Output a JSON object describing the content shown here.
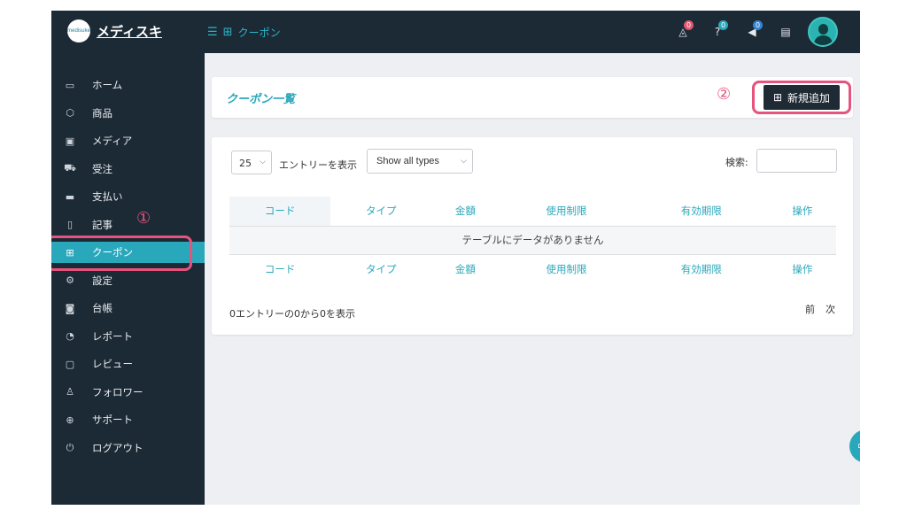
{
  "header": {
    "logo_text": "medisuke",
    "brand": "メディスキ",
    "breadcrumb_icon": "gift-icon",
    "breadcrumb": "クーポン",
    "notifications": {
      "icon": "bell-icon",
      "count": "0",
      "color": "#e2546f"
    },
    "help": {
      "icon": "question-icon",
      "count": "0",
      "color": "#2aa8bb"
    },
    "announcements": {
      "icon": "megaphone-icon",
      "count": "0",
      "color": "#2f86d6"
    },
    "book_icon": "book-icon"
  },
  "sidebar": {
    "items": [
      {
        "label": "ホーム",
        "icon": "monitor-icon",
        "glyph": "▭"
      },
      {
        "label": "商品",
        "icon": "cube-icon",
        "glyph": "⬡"
      },
      {
        "label": "メディア",
        "icon": "image-icon",
        "glyph": "▣"
      },
      {
        "label": "受注",
        "icon": "cart-icon",
        "glyph": "⛟"
      },
      {
        "label": "支払い",
        "icon": "card-icon",
        "glyph": "▬"
      },
      {
        "label": "記事",
        "icon": "document-icon",
        "glyph": "▯"
      },
      {
        "label": "クーポン",
        "icon": "gift-icon",
        "glyph": "⊞",
        "active": true
      },
      {
        "label": "設定",
        "icon": "gears-icon",
        "glyph": "⚙"
      },
      {
        "label": "台帳",
        "icon": "money-icon",
        "glyph": "◙"
      },
      {
        "label": "レポート",
        "icon": "chart-pie-icon",
        "glyph": "◔"
      },
      {
        "label": "レビュー",
        "icon": "comment-icon",
        "glyph": "▢"
      },
      {
        "label": "フォロワー",
        "icon": "shirt-icon",
        "glyph": "♙"
      },
      {
        "label": "サポート",
        "icon": "lifebuoy-icon",
        "glyph": "⊕"
      },
      {
        "label": "ログアウト",
        "icon": "power-icon",
        "glyph": "⏻"
      }
    ]
  },
  "annotations": {
    "marker1": "①",
    "marker2": "②",
    "highlight_color": "#e6537d"
  },
  "page": {
    "title": "クーポン一覧",
    "add_button": {
      "label": "新規追加",
      "icon": "gift-icon"
    }
  },
  "table_controls": {
    "page_length": "25",
    "page_length_suffix": "エントリーを表示",
    "type_filter": "Show all types",
    "search_label": "検索:",
    "search_value": ""
  },
  "table": {
    "columns": [
      "コード",
      "タイプ",
      "金額",
      "使用制限",
      "有効期限",
      "操作"
    ],
    "empty_message": "テーブルにデータがありません",
    "info": "0エントリーの0から0を表示",
    "prev": "前",
    "next": "次"
  },
  "colors": {
    "accent": "#2aa8bb",
    "dark": "#1c2a36"
  }
}
